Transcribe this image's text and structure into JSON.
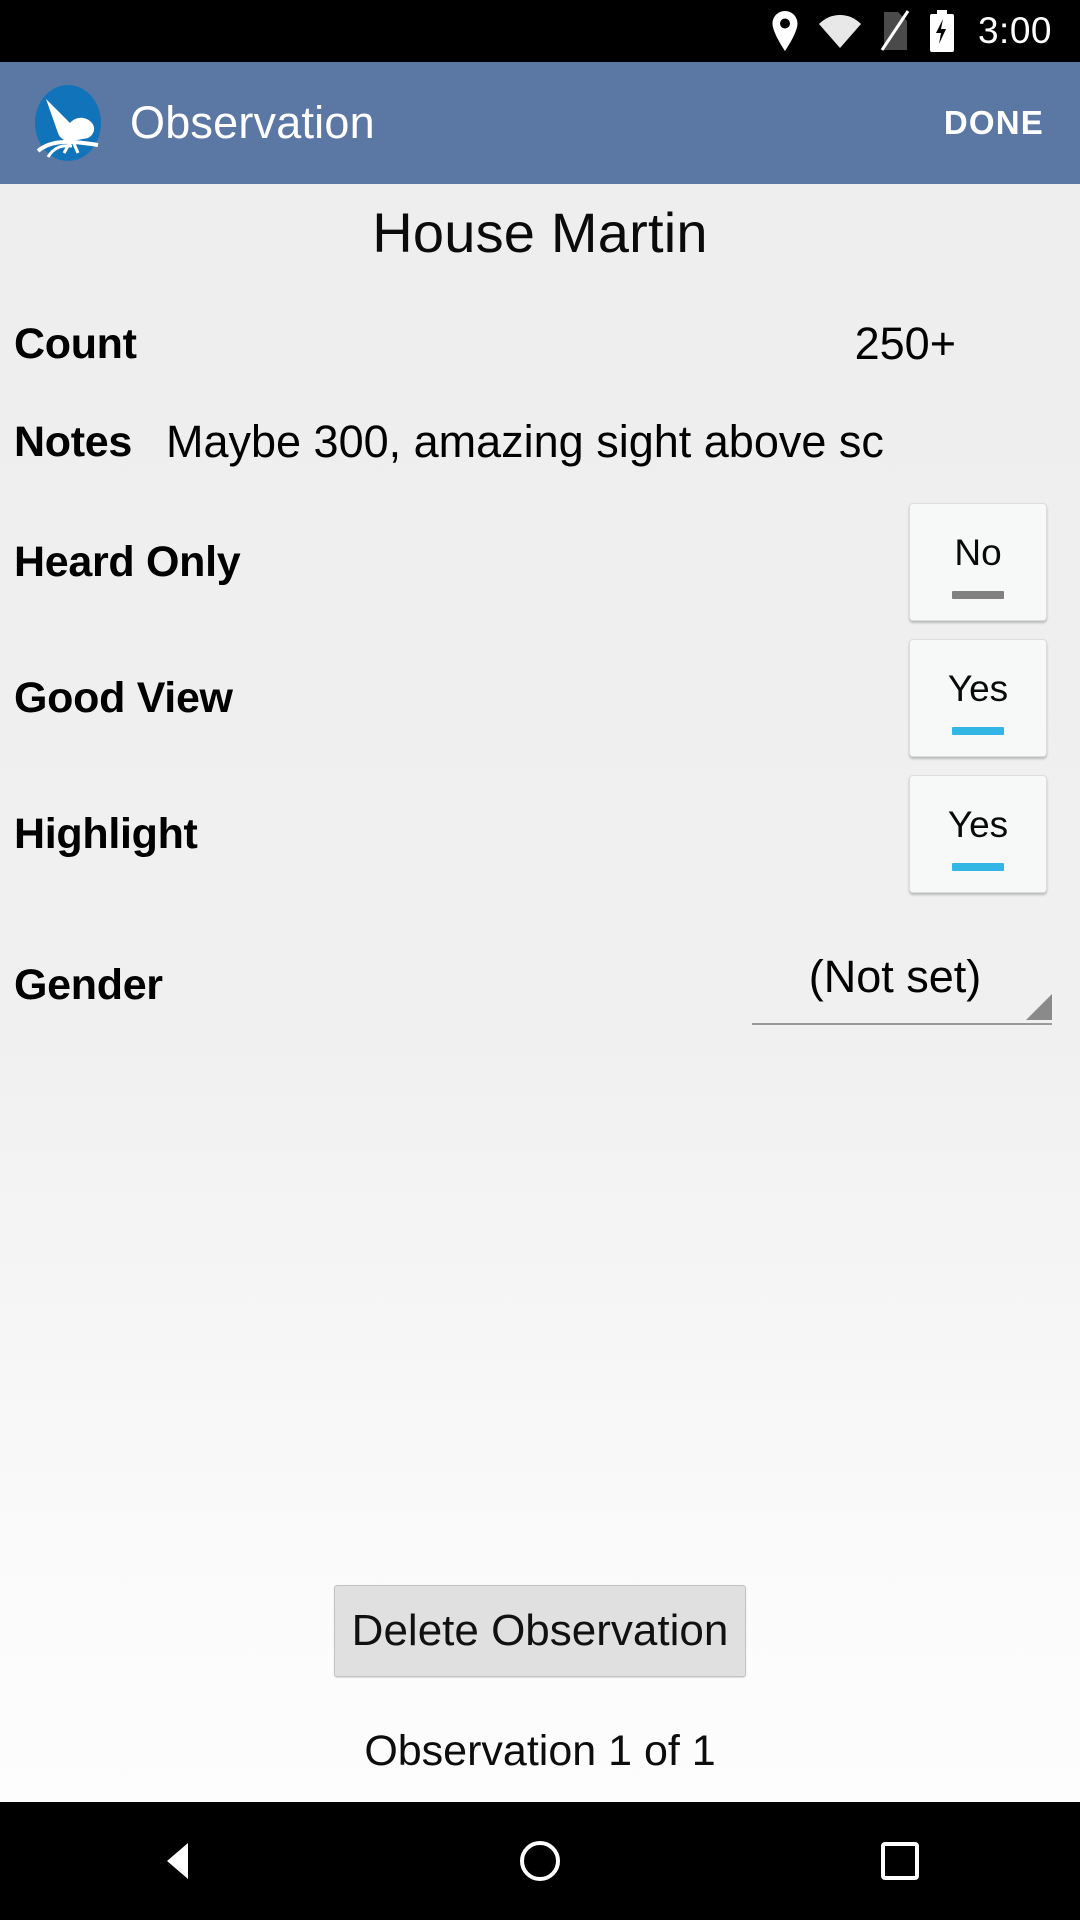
{
  "status_bar": {
    "time": "3:00",
    "icons": [
      "location-pin-icon",
      "wifi-icon",
      "sim-card-off-icon",
      "battery-charging-icon"
    ]
  },
  "app_bar": {
    "logo": "bird-logo-icon",
    "title": "Observation",
    "done_label": "DONE",
    "background_color": "#5b77a3"
  },
  "observation": {
    "species": "House Martin",
    "fields": [
      {
        "label": "Count",
        "value": "250+"
      },
      {
        "label": "Notes",
        "value": "Maybe 300, amazing sight above sc"
      }
    ],
    "toggles": [
      {
        "label": "Heard Only",
        "value": "No",
        "indicator_color": "#808080"
      },
      {
        "label": "Good View",
        "value": "Yes",
        "indicator_color": "#33b5e5"
      },
      {
        "label": "Highlight",
        "value": "Yes",
        "indicator_color": "#33b5e5"
      }
    ],
    "spinner": {
      "label": "Gender",
      "value": "(Not set)",
      "dropdown_icon": "spinner-triangle-icon"
    }
  },
  "footer": {
    "delete_label": "Delete Observation",
    "counter": "Observation 1 of 1"
  },
  "nav_bar": {
    "back": "back-triangle-icon",
    "home": "home-circle-icon",
    "recents": "recents-square-icon"
  }
}
